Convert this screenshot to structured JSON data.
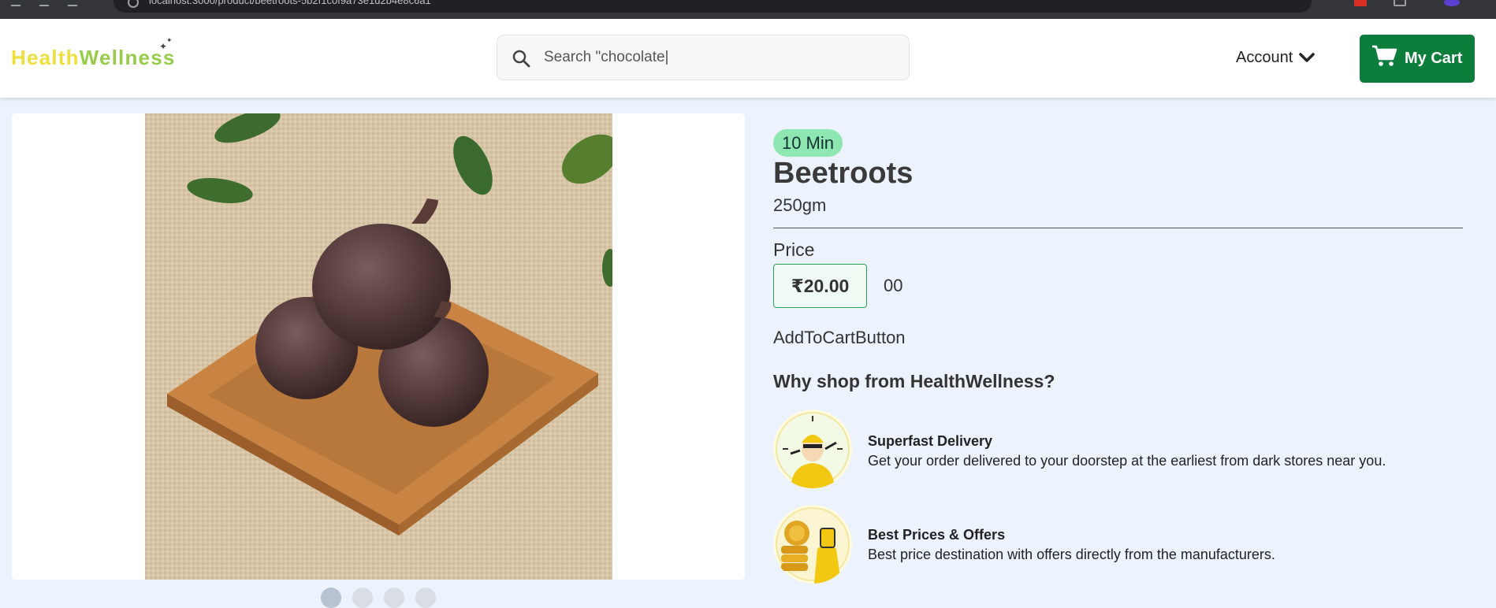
{
  "browser": {
    "url": "localhost:3000/product/beetroots-5b2f1c0f9a73e1d2b4e8c6a1"
  },
  "header": {
    "logo_part1": "Health",
    "logo_part2": "Wellness",
    "search_placeholder": "Search \"chocolate|",
    "account_label": "Account",
    "cart_label": "My Cart"
  },
  "colors": {
    "brand_green": "#0c7d3a",
    "logo_yellow": "#ede03c",
    "logo_green": "#98cd4b",
    "badge_green": "#8ee6b0"
  },
  "product": {
    "delivery_badge": "10 Min",
    "name": "Beetroots",
    "weight": "250gm",
    "price_label": "Price",
    "price": "₹20.00",
    "price_extra": "00",
    "add_to_cart": "AddToCartButton",
    "image_carousel": {
      "slide_count": 4,
      "active_slide": 1
    }
  },
  "why_shop": {
    "heading": "Why shop from HealthWellness?",
    "features": [
      {
        "title": "Superfast Delivery",
        "description": "Get your order delivered to your doorstep at the earliest from dark stores near you.",
        "icon": "delivery-clock-icon"
      },
      {
        "title": "Best Prices & Offers",
        "description": "Best price destination with offers directly from the manufacturers.",
        "icon": "coins-offer-icon"
      }
    ]
  }
}
